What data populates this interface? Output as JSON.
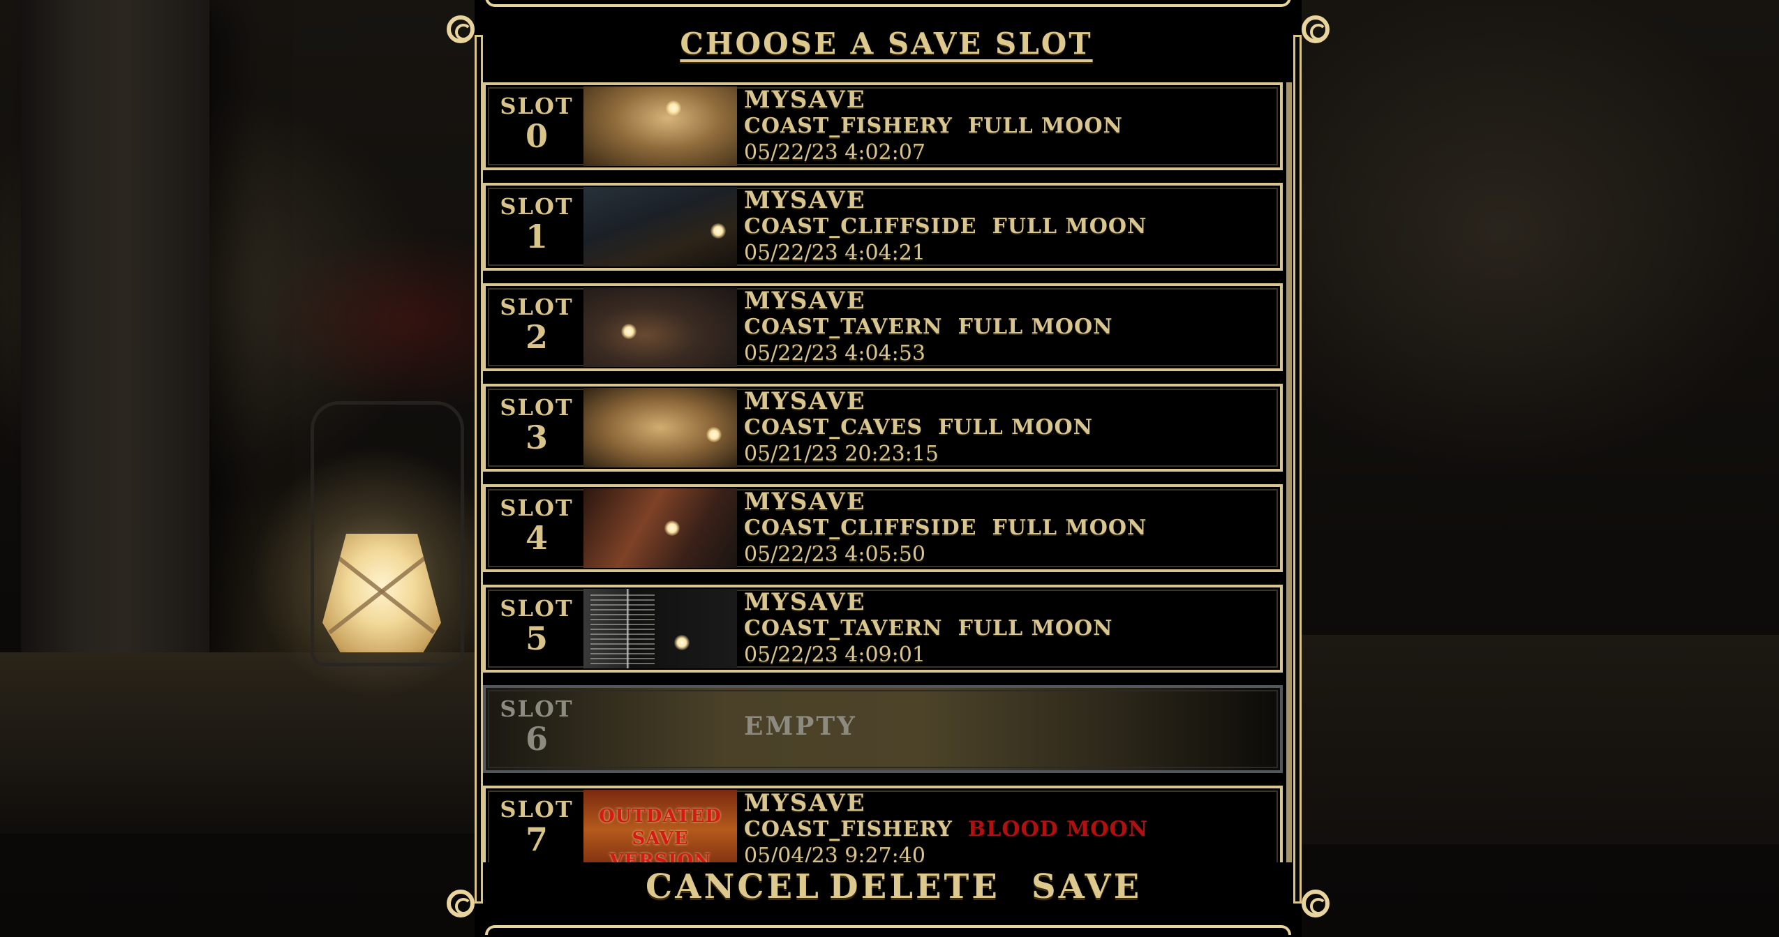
{
  "title": "CHOOSE A SAVE SLOT",
  "slot_word": "SLOT",
  "slots": [
    {
      "number": "0",
      "name": "MYSAVE",
      "location": "COAST_FISHERY",
      "moon": "FULL MOON",
      "date": "05/22/23 4:02:07"
    },
    {
      "number": "1",
      "name": "MYSAVE",
      "location": "COAST_CLIFFSIDE",
      "moon": "FULL MOON",
      "date": "05/22/23 4:04:21"
    },
    {
      "number": "2",
      "name": "MYSAVE",
      "location": "COAST_TAVERN",
      "moon": "FULL MOON",
      "date": "05/22/23 4:04:53"
    },
    {
      "number": "3",
      "name": "MYSAVE",
      "location": "COAST_CAVES",
      "moon": "FULL MOON",
      "date": "05/21/23 20:23:15"
    },
    {
      "number": "4",
      "name": "MYSAVE",
      "location": "COAST_CLIFFSIDE",
      "moon": "FULL MOON",
      "date": "05/22/23 4:05:50"
    },
    {
      "number": "5",
      "name": "MYSAVE",
      "location": "COAST_TAVERN",
      "moon": "FULL MOON",
      "date": "05/22/23 4:09:01"
    },
    {
      "number": "6",
      "empty_label": "EMPTY"
    },
    {
      "number": "7",
      "name": "MYSAVE",
      "location": "COAST_FISHERY",
      "moon": "BLOOD MOON",
      "date": "05/04/23 9:27:40",
      "thumbnail_text": "OUTDATED SAVE VERSION"
    }
  ],
  "buttons": {
    "cancel": "CANCEL",
    "delete": "DELETE",
    "save": "SAVE"
  },
  "colors": {
    "gold": "#ddc88d",
    "blood_moon": "#b0100e",
    "empty_slot_border": "#51575c"
  }
}
